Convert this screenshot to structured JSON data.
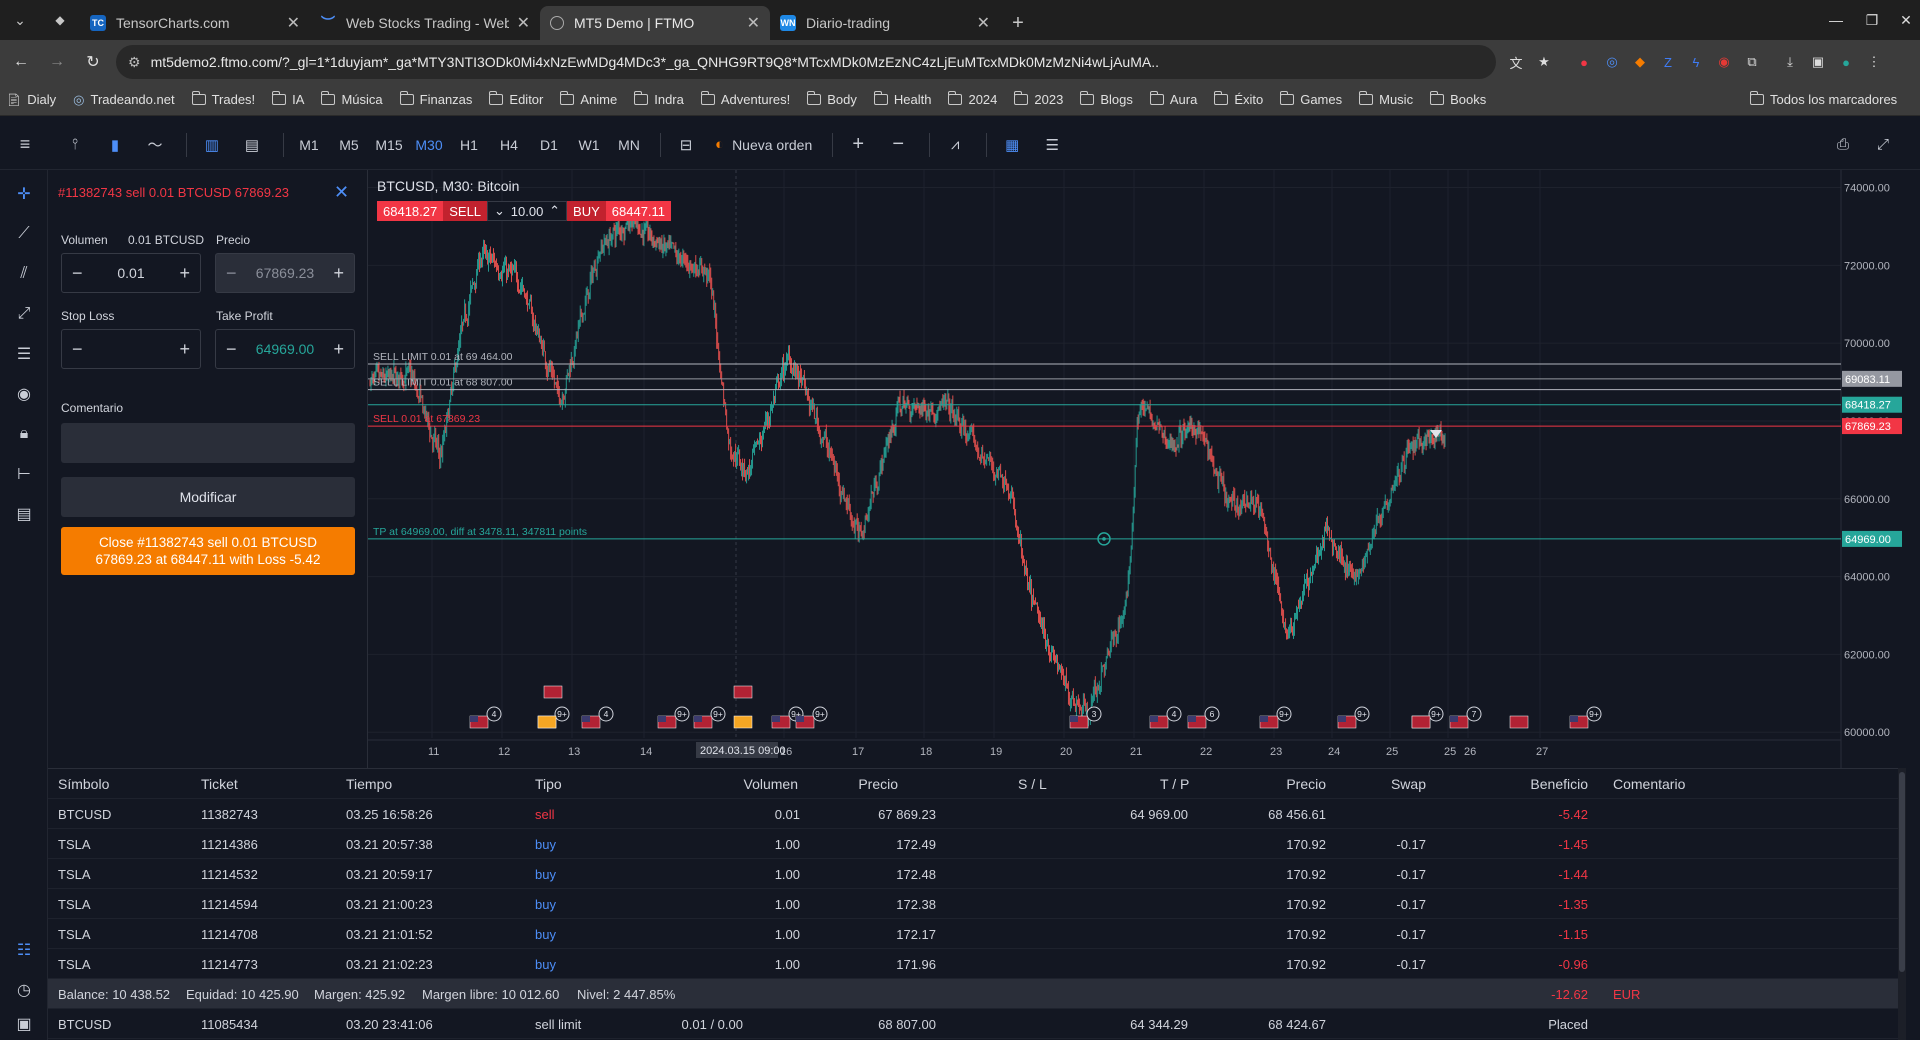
{
  "browser": {
    "tabs": [
      {
        "label": "TensorCharts.com",
        "fav": "TC",
        "fav_bg": "#1565c0"
      },
      {
        "label": "Web Stocks Trading - Webull",
        "fav": "W",
        "fav_bg": "#1f4fd8"
      },
      {
        "label": "MT5 Demo | FTMO",
        "fav": "",
        "fav_bg": "#888888"
      },
      {
        "label": "Diario-trading",
        "fav": "WN",
        "fav_bg": "#1e88e5"
      }
    ],
    "url": "mt5demo2.ftmo.com/?_gl=1*1duyjam*_ga*MTY3NTI3ODk0Mi4xNzEwMDg4MDc3*_ga_QNHG9RT9Q8*MTcxMDk0MzEzNC4zLjEuMTcxMDk0MzMzNi4wLjAuMA..",
    "bookmarks": [
      "Dialy",
      "Tradeando.net",
      "Trades!",
      "IA",
      "Música",
      "Finanzas",
      "Editor",
      "Anime",
      "Indra",
      "Adventures!",
      "Body",
      "Health",
      "2024",
      "2023",
      "Blogs",
      "Aura",
      "Éxito",
      "Games",
      "Music",
      "Books"
    ],
    "all_bookmarks": "Todos los marcadores"
  },
  "toolbar": {
    "timeframes": [
      "M1",
      "M5",
      "M15",
      "M30",
      "H1",
      "H4",
      "D1",
      "W1",
      "MN"
    ],
    "selected_tf": "M30",
    "new_order": "Nueva orden"
  },
  "order_panel": {
    "title": "#11382743 sell 0.01 BTCUSD 67869.23",
    "volume_label": "Volumen",
    "volume_unit": "0.01 BTCUSD",
    "price_label": "Precio",
    "volume_value": "0.01",
    "price_value": "67869.23",
    "sl_label": "Stop Loss",
    "tp_label": "Take Profit",
    "sl_value": "",
    "tp_value": "64969.00",
    "comment_label": "Comentario",
    "modify_label": "Modificar",
    "close_line1": "Close #11382743 sell 0.01 BTCUSD",
    "close_line2": "67869.23 at 68447.11 with Loss -5.42"
  },
  "chart": {
    "title": "BTCUSD, M30: Bitcoin",
    "sell_price": "68418.27",
    "sell_label": "SELL",
    "lot": "10.00",
    "buy_label": "BUY",
    "buy_price": "68447.11",
    "price_ticks": [
      "74000.00",
      "72000.00",
      "70000.00",
      "68000.00",
      "66000.00",
      "64000.00",
      "62000.00",
      "60000.00"
    ],
    "date_ticks": [
      "11",
      "12",
      "13",
      "14",
      "16",
      "17",
      "18",
      "19",
      "20",
      "21",
      "22",
      "23",
      "24",
      "25",
      "25",
      "26",
      "27"
    ],
    "crosshair_date": "2024.03.15 09:00",
    "orders": [
      {
        "text": "SELL LIMIT 0.01 at 69 464.00",
        "price": 69464,
        "color": "#b2b5be"
      },
      {
        "text": "SELL LIMIT 0.01 at 68 807.00",
        "price": 68807,
        "color": "#b2b5be"
      },
      {
        "text": "SELL 0.01 at 67869.23",
        "price": 67869.23,
        "color": "#f23645"
      },
      {
        "text": "TP at 64969.00, diff at 3478.11, 347811 points",
        "price": 64969,
        "color": "#26a69a"
      }
    ],
    "price_labels": [
      {
        "text": "69083.11",
        "price": 69083.11,
        "bg": "#9598a1"
      },
      {
        "text": "68418.27",
        "price": 68418.27,
        "bg": "#26a69a"
      },
      {
        "text": "67869.23",
        "price": 67869.23,
        "bg": "#f23645"
      },
      {
        "text": "64969.00",
        "price": 64969,
        "bg": "#26a69a"
      }
    ],
    "events": [
      "4",
      "9+",
      "4",
      "9+",
      "9+",
      "9+",
      "9+",
      "3",
      "4",
      "6",
      "9+",
      "9+",
      "9+",
      "7",
      "9+"
    ]
  },
  "table": {
    "headers": [
      "Símbolo",
      "Ticket",
      "Tiempo",
      "Tipo",
      "Volumen",
      "Precio",
      "S / L",
      "T / P",
      "Precio",
      "Swap",
      "Beneficio",
      "Comentario"
    ],
    "rows": [
      {
        "symbol": "BTCUSD",
        "ticket": "11382743",
        "time": "03.25 16:58:26",
        "type": "sell",
        "volume": "0.01",
        "price": "67 869.23",
        "sl": "",
        "tp": "64 969.00",
        "cur": "68 456.61",
        "swap": "",
        "profit": "-5.42",
        "comment": ""
      },
      {
        "symbol": "TSLA",
        "ticket": "11214386",
        "time": "03.21 20:57:38",
        "type": "buy",
        "volume": "1.00",
        "price": "172.49",
        "sl": "",
        "tp": "",
        "cur": "170.92",
        "swap": "-0.17",
        "profit": "-1.45",
        "comment": ""
      },
      {
        "symbol": "TSLA",
        "ticket": "11214532",
        "time": "03.21 20:59:17",
        "type": "buy",
        "volume": "1.00",
        "price": "172.48",
        "sl": "",
        "tp": "",
        "cur": "170.92",
        "swap": "-0.17",
        "profit": "-1.44",
        "comment": ""
      },
      {
        "symbol": "TSLA",
        "ticket": "11214594",
        "time": "03.21 21:00:23",
        "type": "buy",
        "volume": "1.00",
        "price": "172.38",
        "sl": "",
        "tp": "",
        "cur": "170.92",
        "swap": "-0.17",
        "profit": "-1.35",
        "comment": ""
      },
      {
        "symbol": "TSLA",
        "ticket": "11214708",
        "time": "03.21 21:01:52",
        "type": "buy",
        "volume": "1.00",
        "price": "172.17",
        "sl": "",
        "tp": "",
        "cur": "170.92",
        "swap": "-0.17",
        "profit": "-1.15",
        "comment": ""
      },
      {
        "symbol": "TSLA",
        "ticket": "11214773",
        "time": "03.21 21:02:23",
        "type": "buy",
        "volume": "1.00",
        "price": "171.96",
        "sl": "",
        "tp": "",
        "cur": "170.92",
        "swap": "-0.17",
        "profit": "-0.96",
        "comment": ""
      }
    ],
    "balance": "Balance: 10 438.52",
    "equity": "Equidad: 10 425.90",
    "margin": "Margen: 425.92",
    "free_margin": "Margen libre: 10 012.60",
    "level": "Nivel: 2 447.85%",
    "total_profit": "-12.62",
    "currency": "EUR",
    "pending": {
      "symbol": "BTCUSD",
      "ticket": "11085434",
      "time": "03.20 23:41:06",
      "type": "sell limit",
      "volume": "0.01 / 0.00",
      "price": "68 807.00",
      "tp": "64 344.29",
      "cur": "68 424.67",
      "status": "Placed"
    }
  }
}
